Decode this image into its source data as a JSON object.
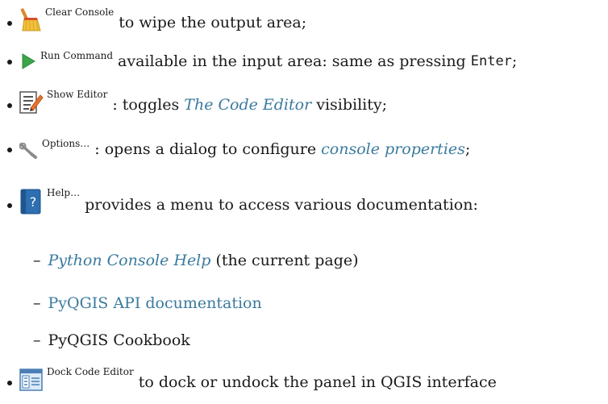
{
  "items": [
    {
      "label": "Clear Console",
      "icon": "broom-icon",
      "text": "to wipe the output area;"
    },
    {
      "label": "Run Command",
      "icon": "run-arrow-icon",
      "text_before": "available in the input area: same as pressing",
      "key": "Enter",
      "text_after": ";"
    },
    {
      "label": "Show Editor",
      "icon": "editor-icon",
      "text_before": ": toggles ",
      "link": "The Code Editor",
      "text_after": " visibility;"
    },
    {
      "label": "Options…",
      "icon": "wrench-icon",
      "text_before": ": opens a dialog to configure ",
      "link": "console properties",
      "text_after": ";"
    },
    {
      "label": "Help…",
      "icon": "help-book-icon",
      "text": "provides a menu to access various documentation:",
      "subitems": [
        {
          "link": "Python Console Help",
          "text": " (the current page)"
        },
        {
          "link": "PyQGIS API documentation"
        },
        {
          "text": "PyQGIS Cookbook"
        }
      ]
    },
    {
      "label": "Dock Code Editor",
      "icon": "dock-editor-icon",
      "text": "to dock or undock the panel in QGIS interface"
    }
  ],
  "colors": {
    "link": "#3a7a9e",
    "text": "#1a1a1a",
    "run_arrow": "#3aa548"
  }
}
